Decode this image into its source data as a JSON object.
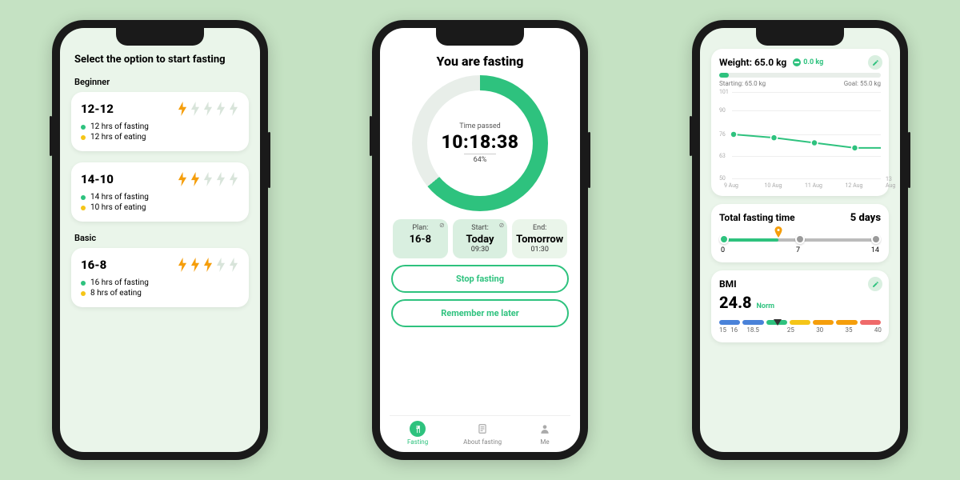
{
  "screen1": {
    "title": "Select the option to start fasting",
    "groups": [
      {
        "label": "Beginner",
        "plans": [
          {
            "name": "12-12",
            "bolts": 1,
            "fasting": "12 hrs of fasting",
            "eating": "12 hrs of eating"
          },
          {
            "name": "14-10",
            "bolts": 2,
            "fasting": "14 hrs of fasting",
            "eating": "10 hrs of eating"
          }
        ]
      },
      {
        "label": "Basic",
        "plans": [
          {
            "name": "16-8",
            "bolts": 3,
            "fasting": "16 hrs of fasting",
            "eating": "8 hrs of eating"
          }
        ]
      }
    ]
  },
  "screen2": {
    "title": "You are fasting",
    "ring": {
      "label": "Time passed",
      "time": "10:18:38",
      "percent_text": "64%",
      "percent_value": 64
    },
    "slots": [
      {
        "head": "Plan:",
        "main": "16-8",
        "sub": "",
        "editable": true
      },
      {
        "head": "Start:",
        "main": "Today",
        "sub": "09:30",
        "editable": true
      },
      {
        "head": "End:",
        "main": "Tomorrow",
        "sub": "01:30",
        "editable": false
      }
    ],
    "buttons": {
      "stop": "Stop fasting",
      "later": "Remember me later"
    },
    "tabs": [
      {
        "label": "Fasting",
        "icon": "utensils-icon",
        "active": true
      },
      {
        "label": "About fasting",
        "icon": "list-icon",
        "active": false
      },
      {
        "label": "Me",
        "icon": "person-icon",
        "active": false
      }
    ]
  },
  "screen3": {
    "weight": {
      "title": "Weight: 65.0 kg",
      "delta": "0.0 kg",
      "starting": "Starting: 65.0 kg",
      "goal": "Goal: 55.0 kg"
    },
    "fasting_total": {
      "title": "Total fasting time",
      "value": "5 days",
      "progress_days": 5,
      "ticks": [
        "0",
        "7",
        "14"
      ]
    },
    "bmi": {
      "title": "BMI",
      "value": "24.8",
      "tag": "Norm",
      "pointer_percent": 36,
      "colors": [
        "#4a82d9",
        "#4a82d9",
        "#2ec27e",
        "#f5c518",
        "#f59e0b",
        "#f59e0b",
        "#ef6a6a"
      ],
      "ticks": [
        "15",
        "16",
        "18.5",
        "25",
        "30",
        "35",
        "40"
      ]
    }
  },
  "chart_data": {
    "type": "line",
    "title": "",
    "ylabel": "",
    "ylim": [
      50,
      101
    ],
    "y_ticks": [
      101,
      90,
      76,
      63,
      50
    ],
    "categories": [
      "9 Aug",
      "10 Aug",
      "11 Aug",
      "12 Aug",
      "13 Aug"
    ],
    "values": [
      76,
      74,
      71,
      68,
      68
    ],
    "series_color": "#2ec27e"
  }
}
